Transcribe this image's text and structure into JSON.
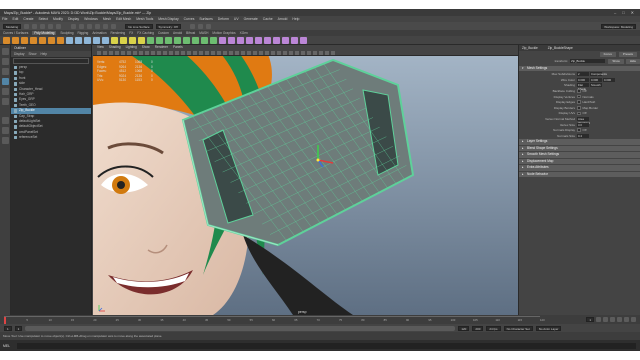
{
  "window": {
    "title": "Maya/Zip_Buckle* - Autodesk MAYA 2023: D:\\3D Work\\Zip Buckle\\Maya/Zip_Buckle.mb* --- Zip"
  },
  "menubar": {
    "items": [
      "File",
      "Edit",
      "Create",
      "Select",
      "Modify",
      "Display",
      "Windows",
      "Mesh",
      "Edit Mesh",
      "Mesh Tools",
      "Mesh Display",
      "Curves",
      "Surfaces",
      "Deform",
      "UV",
      "Generate",
      "Cache",
      "Arnold",
      "Help"
    ]
  },
  "statusline": {
    "workspace_label": "Modeling",
    "symmetry_label": "No Live Surface",
    "symmetry_dropdown": "Symmetry: Off",
    "workspace_menu": "Workspace: Modeling"
  },
  "shelf": {
    "tabs": [
      "Curves / Surfaces",
      "Poly Modeling",
      "Sculpting",
      "Rigging",
      "Animation",
      "Rendering",
      "FX",
      "FX Caching",
      "Custom",
      "Arnold",
      "Bifrost",
      "MASH",
      "Motion Graphics",
      "XGen"
    ],
    "active_tab": "Poly Modeling",
    "icon_colors": [
      "#d98b2b",
      "#d98b2b",
      "#d98b2b",
      "#d98b2b",
      "#d98b2b",
      "#d98b2b",
      "#d98b2b",
      "#8fb7d9",
      "#8fb7d9",
      "#8fb7d9",
      "#8fb7d9",
      "#8fb7d9",
      "#d9d24a",
      "#d9d24a",
      "#d9d24a",
      "#d9d24a",
      "#6dbd71",
      "#6dbd71",
      "#6dbd71",
      "#6dbd71",
      "#6dbd71",
      "#6dbd71",
      "#6dbd71",
      "#6dbd71",
      "#bb86d6",
      "#bb86d6",
      "#bb86d6",
      "#bb86d6",
      "#bb86d6",
      "#bb86d6",
      "#bb86d6",
      "#bb86d6",
      "#bb86d6",
      "#bb86d6"
    ]
  },
  "outliner": {
    "title": "Outliner",
    "menu": [
      "Display",
      "Show",
      "Help"
    ],
    "search_placeholder": "Search...",
    "items": [
      {
        "label": "persp",
        "selected": false
      },
      {
        "label": "top",
        "selected": false
      },
      {
        "label": "front",
        "selected": false
      },
      {
        "label": "side",
        "selected": false
      },
      {
        "label": "Character_Head",
        "selected": false
      },
      {
        "label": "Hair_GRP",
        "selected": false
      },
      {
        "label": "Eyes_GRP",
        "selected": false
      },
      {
        "label": "Teeth_GEO",
        "selected": false
      },
      {
        "label": "Zip_Buckle",
        "selected": true
      },
      {
        "label": "Cap_Strap",
        "selected": false
      },
      {
        "label": "defaultLightSet",
        "selected": false
      },
      {
        "label": "defaultObjectSet",
        "selected": false
      },
      {
        "label": "cmdPanelSet",
        "selected": false
      },
      {
        "label": "referenceSet",
        "selected": false
      }
    ]
  },
  "viewport": {
    "menu": [
      "View",
      "Shading",
      "Lighting",
      "Show",
      "Renderer",
      "Panels"
    ],
    "hud": [
      {
        "label": "Verts:",
        "a": "4752",
        "b": "1068",
        "c": "0"
      },
      {
        "label": "Edges:",
        "a": "9264",
        "b": "2136",
        "c": "0"
      },
      {
        "label": "Faces:",
        "a": "4512",
        "b": "1068",
        "c": "0"
      },
      {
        "label": "Tris:",
        "a": "9024",
        "b": "2136",
        "c": "0"
      },
      {
        "label": "UVs:",
        "a": "5130",
        "b": "1153",
        "c": "0"
      }
    ],
    "camera_label": "persp",
    "bg_top": "#a6b7c8",
    "bg_bottom": "#5e6f83",
    "wire_color": "#5ed19a",
    "hair_green": "#1f8a4d",
    "cap_orange": "#e07a12"
  },
  "attribute_editor": {
    "tabs": [
      "Zip_Buckle",
      "Zip_BuckleShape"
    ],
    "focus_label": "Focus",
    "presets_label": "Presets",
    "show_label": "Show",
    "hide_label": "Hide",
    "transform_label": "transform:",
    "transform_value": "Zip_Buckle",
    "sections": [
      {
        "title": "Mesh Settings",
        "open": true
      },
      {
        "title": "Layer Settings",
        "open": false
      },
      {
        "title": "Blend Shape Settings",
        "open": false
      },
      {
        "title": "Smooth Mesh Settings",
        "open": false
      },
      {
        "title": "Displacement Map",
        "open": false
      },
      {
        "title": "Extra Attributes",
        "open": false
      },
      {
        "title": "Node Behavior",
        "open": false
      }
    ],
    "fields": [
      {
        "label": "Max Subdivisions",
        "type": "values",
        "values": [
          "2",
          "Components"
        ]
      },
      {
        "label": "Wire Color",
        "type": "values",
        "values": [
          "0.000",
          "0.000",
          "0.000"
        ]
      },
      {
        "label": "Shading",
        "type": "values",
        "values": [
          "Flat Shade",
          "Smooth"
        ]
      },
      {
        "label": "Backface Culling",
        "type": "check",
        "values": [
          "Off"
        ]
      },
      {
        "label": "Display Vertices",
        "type": "check",
        "values": [
          "Normals"
        ]
      },
      {
        "label": "Display Edges",
        "type": "check",
        "values": [
          "Hard/Soft"
        ]
      },
      {
        "label": "Display Borders",
        "type": "check",
        "values": [
          "Map Border"
        ]
      },
      {
        "label": "Display UVs",
        "type": "check",
        "values": [
          "Off"
        ]
      },
      {
        "label": "Vertex Normal Method",
        "type": "values",
        "values": [
          "Area Weighted"
        ]
      },
      {
        "label": "Vertex Size",
        "type": "values",
        "values": [
          "3.0"
        ]
      },
      {
        "label": "Normals Display",
        "type": "check",
        "values": [
          "Off"
        ]
      },
      {
        "label": "Normals Size",
        "type": "values",
        "values": [
          "0.4"
        ]
      }
    ]
  },
  "timeslider": {
    "ticks": [
      "1",
      "5",
      "10",
      "15",
      "20",
      "25",
      "30",
      "35",
      "40",
      "45",
      "50",
      "55",
      "60",
      "65",
      "70",
      "75",
      "80",
      "85",
      "90",
      "95",
      "100",
      "105",
      "110",
      "115",
      "120"
    ],
    "current_frame": "1"
  },
  "rangeslider": {
    "start": "1",
    "inner_start": "1",
    "inner_end": "120",
    "end": "200",
    "fps": "24 fps",
    "char_set": "No Character Set",
    "anim_layer": "No Anim Layer"
  },
  "helpline": {
    "text": "Move Tool: Use manipulator to move object(s). Ctrl+LMB+Drag on manipulator axis to move along the associated plane."
  },
  "cmdline": {
    "mode": "MEL",
    "text": ""
  }
}
